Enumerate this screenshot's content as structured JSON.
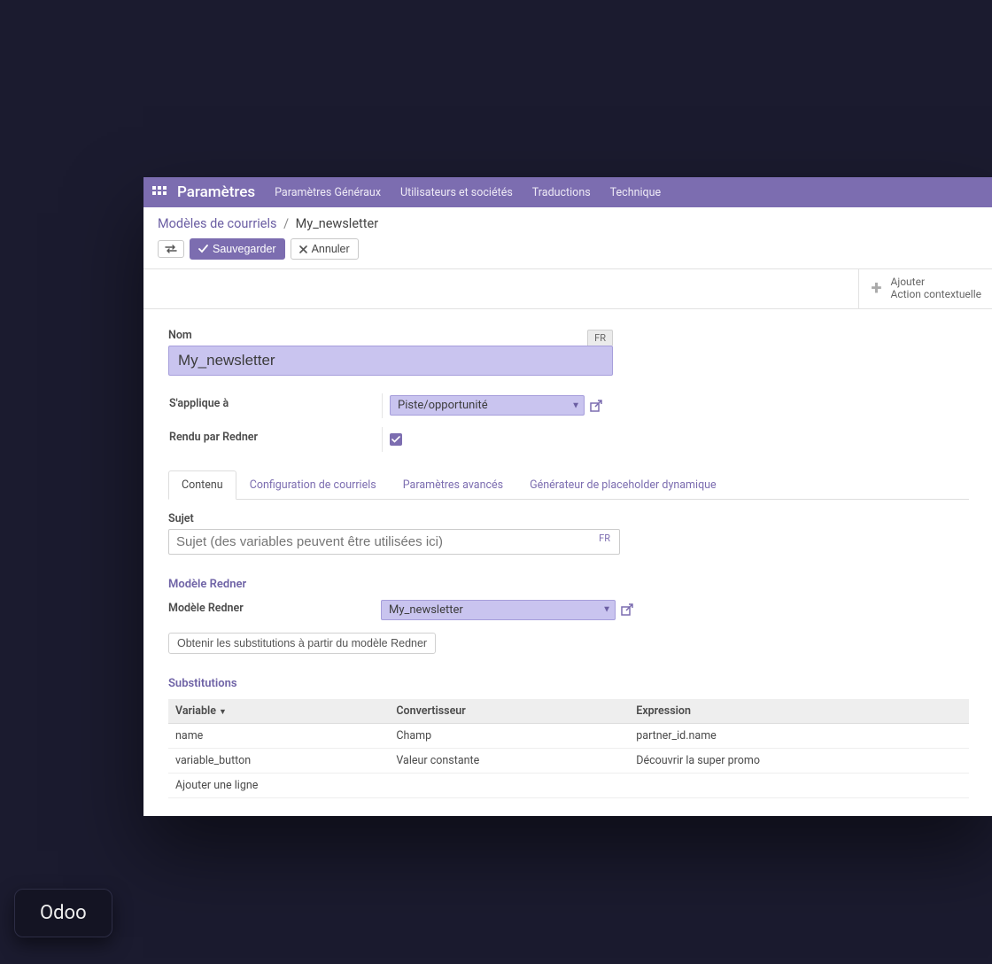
{
  "nav": {
    "brand": "Paramètres",
    "items": [
      "Paramètres Généraux",
      "Utilisateurs et sociétés",
      "Traductions",
      "Technique"
    ]
  },
  "breadcrumb": {
    "parent": "Modèles de courriels",
    "sep": "/",
    "current": "My_newsletter"
  },
  "actions": {
    "save": "Sauvegarder",
    "cancel": "Annuler"
  },
  "context_action": {
    "line1": "Ajouter",
    "line2": "Action contextuelle"
  },
  "form": {
    "name_label": "Nom",
    "name_value": "My_newsletter",
    "lang_badge": "FR",
    "applies_label": "S'applique à",
    "applies_value": "Piste/opportunité",
    "redner_render_label": "Rendu par Redner",
    "redner_render_checked": true
  },
  "tabs": [
    "Contenu",
    "Configuration de courriels",
    "Paramètres avancés",
    "Générateur de placeholder dynamique"
  ],
  "content": {
    "subject_label": "Sujet",
    "subject_placeholder": "Sujet (des variables peuvent être utilisées ici)",
    "subject_lang": "FR",
    "redner_section": "Modèle Redner",
    "redner_model_label": "Modèle Redner",
    "redner_model_value": "My_newsletter",
    "get_subs_button": "Obtenir les substitutions à partir du modèle Redner",
    "subs_section": "Substitutions"
  },
  "subs_table": {
    "headers": {
      "variable": "Variable",
      "converter": "Convertisseur",
      "expression": "Expression"
    },
    "rows": [
      {
        "variable": "name",
        "converter": "Champ",
        "expression": "partner_id.name"
      },
      {
        "variable": "variable_button",
        "converter": "Valeur constante",
        "expression": "Découvrir la super promo"
      }
    ],
    "add_line": "Ajouter une ligne"
  },
  "badge": "Odoo"
}
